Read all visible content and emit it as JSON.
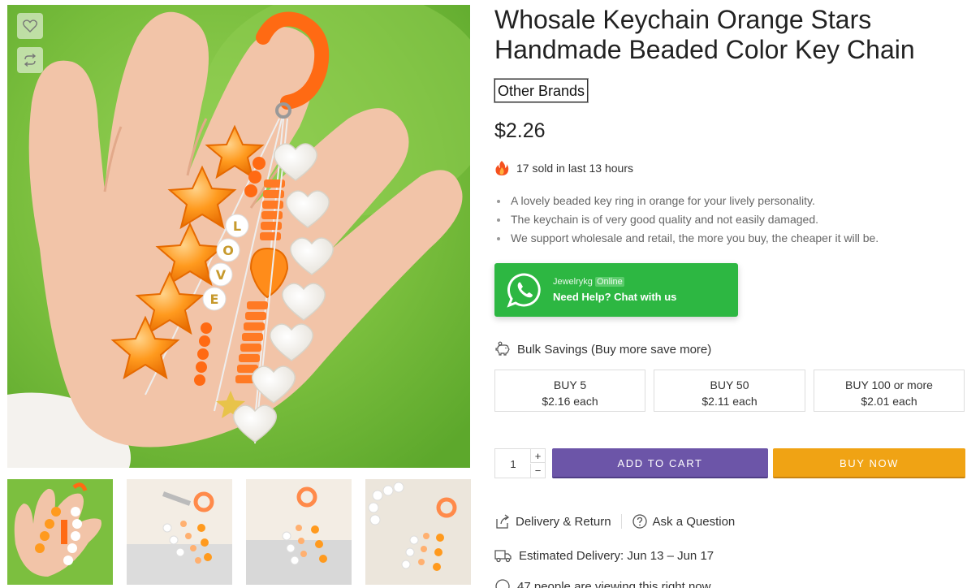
{
  "product": {
    "title": "Whosale Keychain Orange Stars Handmade Beaded Color Key Chain",
    "brand": "Other Brands",
    "price": "$2.26",
    "sold_text": "17 sold in last 13 hours",
    "features": [
      "A lovely beaded key ring in orange for your lively personality.",
      "The keychain is of very good quality and not easily damaged.",
      "We support wholesale and retail, the more you buy, the cheaper it will be."
    ]
  },
  "whatsapp": {
    "store": "Jewelrykg",
    "status": "Online",
    "cta": "Need Help? Chat with us"
  },
  "bulk": {
    "heading": "Bulk Savings (Buy more save more)",
    "tiers": [
      {
        "label": "BUY 5",
        "price": "$2.16 each"
      },
      {
        "label": "BUY 50",
        "price": "$2.11 each"
      },
      {
        "label": "BUY 100 or more",
        "price": "$2.01 each"
      }
    ]
  },
  "purchase": {
    "quantity": "1",
    "plus": "+",
    "minus": "−",
    "add_to_cart": "ADD TO CART",
    "buy_now": "BUY NOW"
  },
  "links": {
    "delivery_return": "Delivery & Return",
    "ask_question": "Ask a Question"
  },
  "delivery": {
    "estimated": "Estimated Delivery: Jun 13 – Jun 17"
  },
  "viewing": "47 people are viewing this right now",
  "gallery": {
    "bead_letters": [
      "L",
      "O",
      "V",
      "E"
    ]
  },
  "colors": {
    "whatsapp_green": "#2db742",
    "add_to_cart": "#6c55a8",
    "buy_now": "#f0a314",
    "bead_orange": "#ff6a13"
  }
}
